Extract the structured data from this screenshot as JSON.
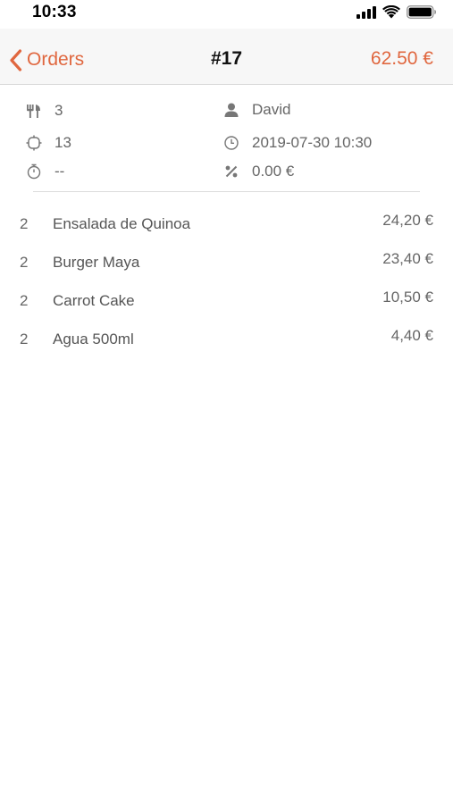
{
  "status_bar": {
    "time": "10:33",
    "icons": [
      "cellular-signal-icon",
      "wifi-icon",
      "battery-icon"
    ]
  },
  "nav": {
    "back_label": "Orders",
    "title": "#17",
    "total": "62.50 €",
    "accent_color": "#e0673f"
  },
  "info": {
    "covers": "3",
    "waiter": "David",
    "table": "13",
    "datetime": "2019-07-30 10:30",
    "duration": "--",
    "discount": "0.00 €",
    "icons": {
      "covers": "cutlery-icon",
      "waiter": "person-icon",
      "table": "table-icon",
      "datetime": "clock-icon",
      "duration": "timer-icon",
      "discount": "percent-icon"
    }
  },
  "items": [
    {
      "qty": "2",
      "name": "Ensalada de Quinoa",
      "price": "24,20 €"
    },
    {
      "qty": "2",
      "name": "Burger Maya",
      "price": "23,40 €"
    },
    {
      "qty": "2",
      "name": "Carrot Cake",
      "price": "10,50 €"
    },
    {
      "qty": "2",
      "name": "Agua 500ml",
      "price": "4,40 €"
    }
  ]
}
